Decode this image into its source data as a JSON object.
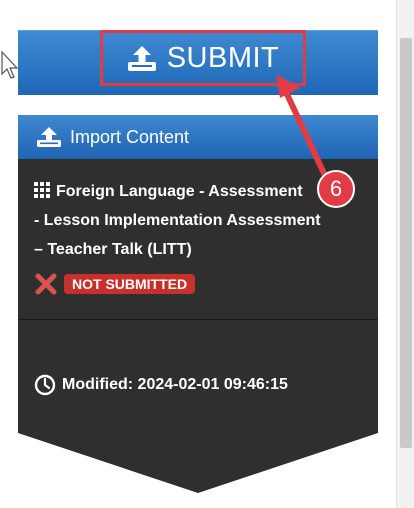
{
  "toolbar": {
    "submit_label": "SUBMIT"
  },
  "card": {
    "header_label": "Import Content",
    "title_line1": "Foreign Language - Assessment",
    "title_line2": "- Lesson Implementation Assessment",
    "title_line3": "– Teacher Talk (LITT)",
    "status": "NOT SUBMITTED",
    "modified": "Modified: 2024-02-01 09:46:15"
  },
  "annotation": {
    "step": "6"
  },
  "colors": {
    "accent_blue": "#2064b4",
    "card_bg": "#2f2f2f",
    "status_red": "#c8302b",
    "annotation_red": "#e23b44"
  },
  "icons": [
    "upload-icon",
    "grid-icon",
    "x-icon",
    "clock-icon",
    "cursor-icon"
  ]
}
